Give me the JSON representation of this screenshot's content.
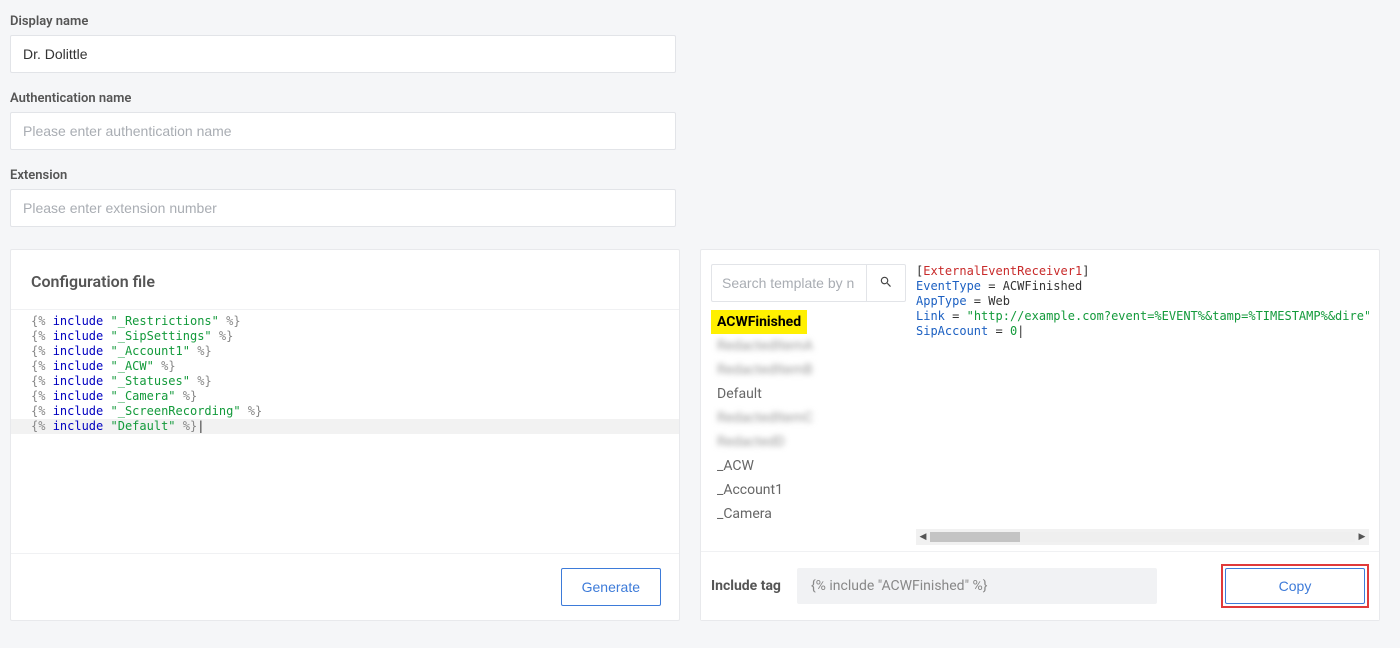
{
  "form": {
    "display_name": {
      "label": "Display name",
      "value": "Dr. Dolittle",
      "placeholder": ""
    },
    "auth_name": {
      "label": "Authentication name",
      "value": "",
      "placeholder": "Please enter authentication name"
    },
    "extension": {
      "label": "Extension",
      "value": "",
      "placeholder": "Please enter extension number"
    }
  },
  "config_panel": {
    "title": "Configuration file",
    "lines": [
      {
        "include": "_Restrictions"
      },
      {
        "include": "_SipSettings"
      },
      {
        "include": "_Account1"
      },
      {
        "include": "_ACW"
      },
      {
        "include": "_Statuses"
      },
      {
        "include": "_Camera"
      },
      {
        "include": "_ScreenRecording"
      },
      {
        "include": "Default",
        "highlight": true,
        "cursor": true
      }
    ],
    "generate_label": "Generate"
  },
  "template_panel": {
    "search_placeholder": "Search template by n",
    "items": [
      {
        "label": "ACWFinished",
        "selected": true
      },
      {
        "label": "RedactedItemA",
        "blurred": true
      },
      {
        "label": "RedactedItemB",
        "blurred": true
      },
      {
        "label": "Default"
      },
      {
        "label": "RedactedItemC",
        "blurred": true
      },
      {
        "label": "RedactedD",
        "blurred": true
      },
      {
        "label": "_ACW"
      },
      {
        "label": "_Account1"
      },
      {
        "label": "_Camera"
      }
    ],
    "preview": {
      "section": "ExternalEventReceiver1",
      "rows": [
        {
          "key": "EventType",
          "type": "plain",
          "value": "ACWFinished"
        },
        {
          "key": "AppType",
          "type": "plain",
          "value": "Web"
        },
        {
          "key": "Link",
          "type": "string",
          "value": "http://example.com?event=%EVENT%&tamp=%TIMESTAMP%&dire"
        },
        {
          "key": "SipAccount",
          "type": "num",
          "value": "0",
          "cursor": true
        }
      ]
    },
    "footer": {
      "label": "Include tag",
      "readout": "{% include \"ACWFinished\" %}",
      "copy_label": "Copy"
    }
  }
}
